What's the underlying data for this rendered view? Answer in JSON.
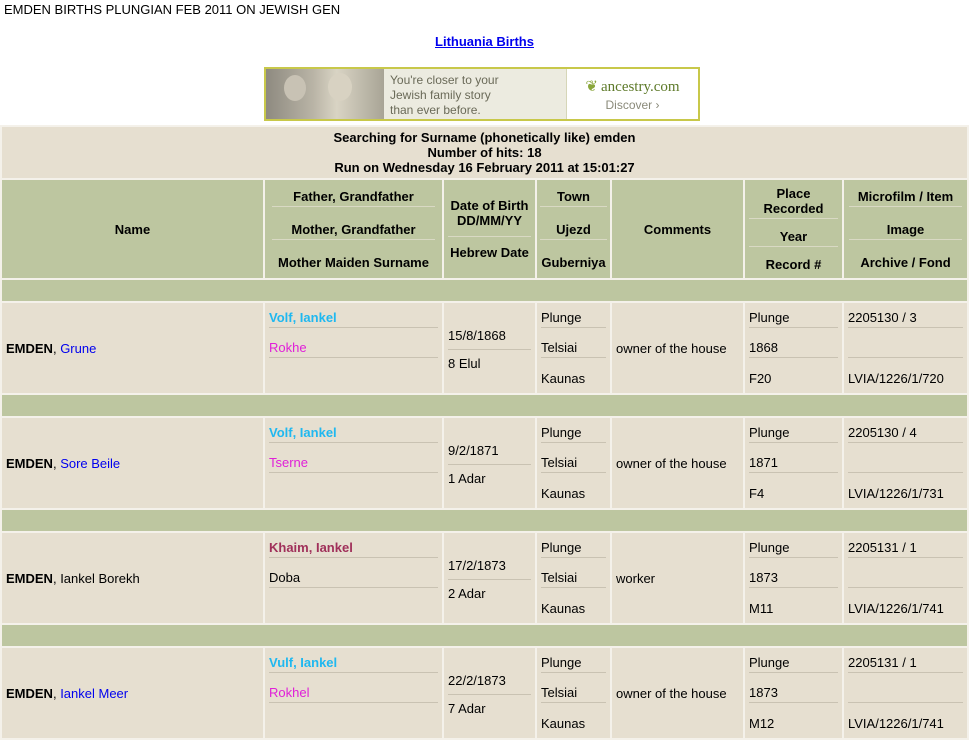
{
  "page": {
    "title": "EMDEN BIRTHS PLUNGIAN FEB 2011 ON JEWISH GEN",
    "region_link": "Lithuania Births"
  },
  "ad": {
    "line1": "You're closer to your",
    "line2": "Jewish family story",
    "line3": "than ever before.",
    "brand": "ancestry.com",
    "cta": "Discover ›"
  },
  "search": {
    "line1": "Searching for Surname (phonetically like) emden",
    "line2": "Number of hits: 18",
    "line3": "Run on Wednesday 16 February 2011 at 15:01:27"
  },
  "headers": {
    "name": "Name",
    "family": [
      "Father, Grandfather",
      "Mother, Grandfather",
      "Mother Maiden Surname"
    ],
    "dob": [
      "Date of Birth DD/MM/YY",
      "Hebrew Date"
    ],
    "place": [
      "Town",
      "Ujezd",
      "Guberniya"
    ],
    "comments": "Comments",
    "record": [
      "Place Recorded",
      "Year",
      "Record #"
    ],
    "film": [
      "Microfilm / Item",
      "Image",
      "Archive / Fond"
    ]
  },
  "records": [
    {
      "surname": "EMDEN",
      "given": "Grune",
      "father": "Volf, Iankel",
      "mother": "Rokhe",
      "dob": "15/8/1868",
      "hebrew": "8 Elul",
      "town": "Plunge",
      "ujezd": "Telsiai",
      "guberniya": "Kaunas",
      "comment": "owner of the house",
      "place_rec": "Plunge",
      "year": "1868",
      "record": "F20",
      "film": "2205130 / 3",
      "image": "",
      "archive": "LVIA/1226/1/720"
    },
    {
      "surname": "EMDEN",
      "given": "Sore Beile",
      "father": "Volf, Iankel",
      "mother": "Tserne",
      "dob": "9/2/1871",
      "hebrew": "1 Adar",
      "town": "Plunge",
      "ujezd": "Telsiai",
      "guberniya": "Kaunas",
      "comment": "owner of the house",
      "place_rec": "Plunge",
      "year": "1871",
      "record": "F4",
      "film": "2205130 / 4",
      "image": "",
      "archive": "LVIA/1226/1/731"
    },
    {
      "surname": "EMDEN",
      "given": "Iankel Borekh",
      "father": "Khaim, Iankel",
      "mother": "Doba",
      "dob": "17/2/1873",
      "hebrew": "2 Adar",
      "town": "Plunge",
      "ujezd": "Telsiai",
      "guberniya": "Kaunas",
      "comment": "worker",
      "place_rec": "Plunge",
      "year": "1873",
      "record": "M11",
      "film": "2205131 / 1",
      "image": "",
      "archive": "LVIA/1226/1/741"
    },
    {
      "surname": "EMDEN",
      "given": "Iankel Meer",
      "father": "Vulf, Iankel",
      "mother": "Rokhel",
      "dob": "22/2/1873",
      "hebrew": "7 Adar",
      "town": "Plunge",
      "ujezd": "Telsiai",
      "guberniya": "Kaunas",
      "comment": "owner of the house",
      "place_rec": "Plunge",
      "year": "1873",
      "record": "M12",
      "film": "2205131 / 1",
      "image": "",
      "archive": "LVIA/1226/1/741"
    }
  ],
  "colors": {
    "header_bg": "#bdc6a0",
    "cell_bg": "#e6dfd0",
    "link": "#0000ee",
    "father_cyan": "#1fb8f0",
    "father_maroon": "#a0305a",
    "mother_magenta": "#e020d8"
  }
}
